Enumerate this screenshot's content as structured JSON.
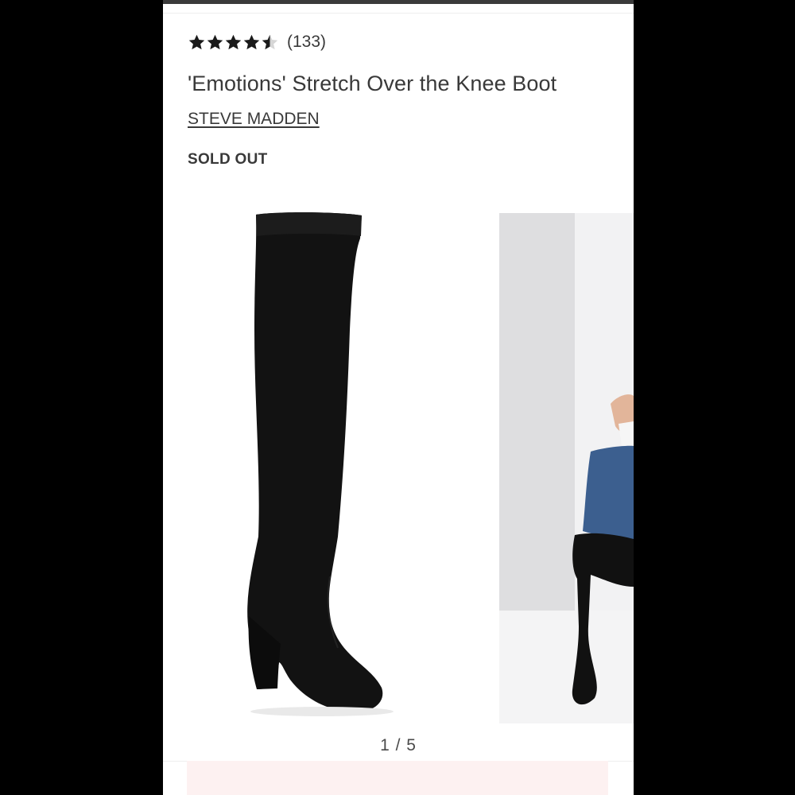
{
  "product": {
    "rating_value": 4.5,
    "rating_max": 5,
    "review_count": "(133)",
    "title": "'Emotions' Stretch Over the Knee Boot",
    "brand": "STEVE MADDEN",
    "status": "SOLD OUT"
  },
  "gallery": {
    "pager": "1 / 5",
    "current_index": 1,
    "total": 5,
    "images": [
      {
        "alt": "black over the knee boot side view"
      },
      {
        "alt": "model wearing boot with jeans"
      }
    ]
  },
  "icons": {
    "star_full": "star-filled-icon",
    "star_half": "star-half-icon"
  },
  "colors": {
    "text": "#393939",
    "boot": "#111111",
    "star": "#1a1a1a",
    "star_empty": "#cfcfcf",
    "denim": "#3c5f8f"
  }
}
